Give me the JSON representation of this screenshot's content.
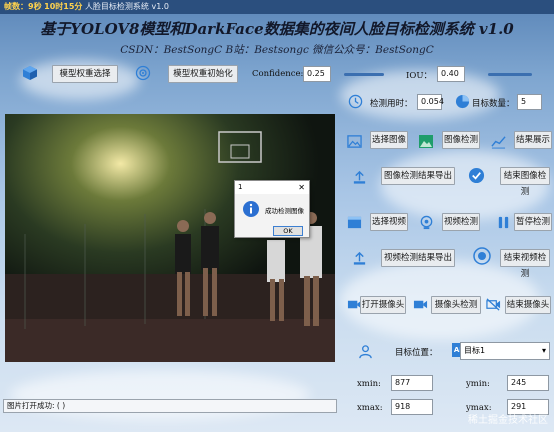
{
  "window": {
    "title_prefix": "帧数：",
    "fps": "9",
    "frames_label": "秒",
    "clock": "10时15分",
    "title_text": "人脸目标检测系统 v1.0"
  },
  "header": {
    "title": "基于YOLOV8模型和DarkFace数据集的夜间人脸目标检测系统 v1.0",
    "subtitle": "CSDN：BestSongC   B站：Bestsongc   微信公众号：BestSongC"
  },
  "model": {
    "select_label": "模型权重选择",
    "init_label": "模型权重初始化",
    "confidence_label": "Confidence:",
    "confidence_value": "0.25",
    "iou_label": "IOU：",
    "iou_value": "0.40"
  },
  "stats": {
    "time_label": "检测用时：",
    "time_value": "0.054",
    "count_label": "目标数量：",
    "count_value": "5"
  },
  "image_panel": {
    "select_image": "选择图像",
    "detect_image": "图像检测",
    "show_result": "结果展示",
    "export_image": "图像检测结果导出",
    "end_image": "结束图像检测"
  },
  "video_panel": {
    "select_video": "选择视频",
    "detect_video": "视频检测",
    "pause_detect": "暂停检测",
    "export_video": "视频检测结果导出",
    "end_video": "结束视频检测"
  },
  "camera_panel": {
    "open_camera": "打开摄像头",
    "camera_detect": "摄像头检测",
    "end_camera": "结束摄像头"
  },
  "position": {
    "label": "目标位置：",
    "target_select": "目标1",
    "all_label": "ALL",
    "xmin_label": "xmin:",
    "xmin_value": "877",
    "ymin_label": "ymin:",
    "ymin_value": "245",
    "xmax_label": "xmax:",
    "xmax_value": "918",
    "ymax_label": "ymax:",
    "ymax_value": "291"
  },
  "status": {
    "text": "图片打开成功: ( )"
  },
  "dialog": {
    "title": "1",
    "message": "成功检测图像",
    "ok_label": "OK",
    "close_label": "✕"
  },
  "watermark": "稀土掘金技术社区"
}
